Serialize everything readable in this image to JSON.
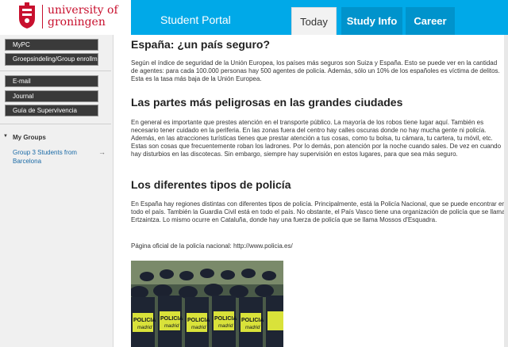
{
  "header": {
    "logo_line1": "university of",
    "logo_line2": "groningen",
    "portal_title": "Student Portal",
    "tabs": [
      {
        "label": "Today",
        "active": true
      },
      {
        "label": "Study Info",
        "active": false
      },
      {
        "label": "Career",
        "active": false
      }
    ],
    "brand_color": "#00a9e8",
    "logo_color": "#c8102e"
  },
  "sidebar": {
    "items": [
      {
        "label": "MyPC"
      },
      {
        "label": "Groepsindeling/Group enrollment"
      },
      {
        "label": "E-mail"
      },
      {
        "label": "Journal"
      },
      {
        "label": "Guía de Supervivencia"
      }
    ],
    "groups_heading": "My Groups",
    "group_link": "Group 3 Students from Barcelona",
    "group_arrow": "→"
  },
  "article": {
    "h1": "España: ¿un país seguro?",
    "p1": "Según el índice de seguridad de la Unión Europea, los países más seguros son Suiza y España. Esto se puede ver en la cantidad de agentes: para cada 100.000 personas hay 500 agentes de policía. Además, sólo un 10% de los españoles es víctima de delitos. Esta es la tasa más baja de la Unión Europea.",
    "h2": "Las partes más peligrosas en las grandes ciudades",
    "p2": "En general es importante que prestes atención en el transporte público. La mayoría de los robos tiene lugar aquí. También es necesario tener cuidado en la periferia. En las zonas fuera del centro hay calles oscuras donde no hay mucha gente ni policía. Además, en las atracciones turísticas tienes que prestar atención a tus cosas, como tu bolsa, tu cámara, tu cartera, tu móvil, etc. Estas son cosas que frecuentemente roban los ladrones. Por lo demás, pon atención por la noche cuando sales. De vez en cuando hay disturbios en las discotecas. Sin embargo, siempre hay supervisión en estos lugares, para que sea más seguro.",
    "h3": "Los diferentes tipos de policía",
    "p3": "En España hay regiones distintas con diferentes tipos de policía. Principalmente, está la Policía Nacional, que se puede encontrar en todo el país. También la Guardia Civil está en todo el país. No obstante, el País Vasco tiene una organización de policía que se llama Ertzaintza. Lo mismo ocurre en Cataluña, donde hay una fuerza de policía que se llama Mossos d'Esquadra.",
    "p4": "Página oficial de la policía nacional: http://www.policia.es/",
    "photo_vest_text": "POLICIA",
    "photo_vest_subtext": "madrid"
  }
}
